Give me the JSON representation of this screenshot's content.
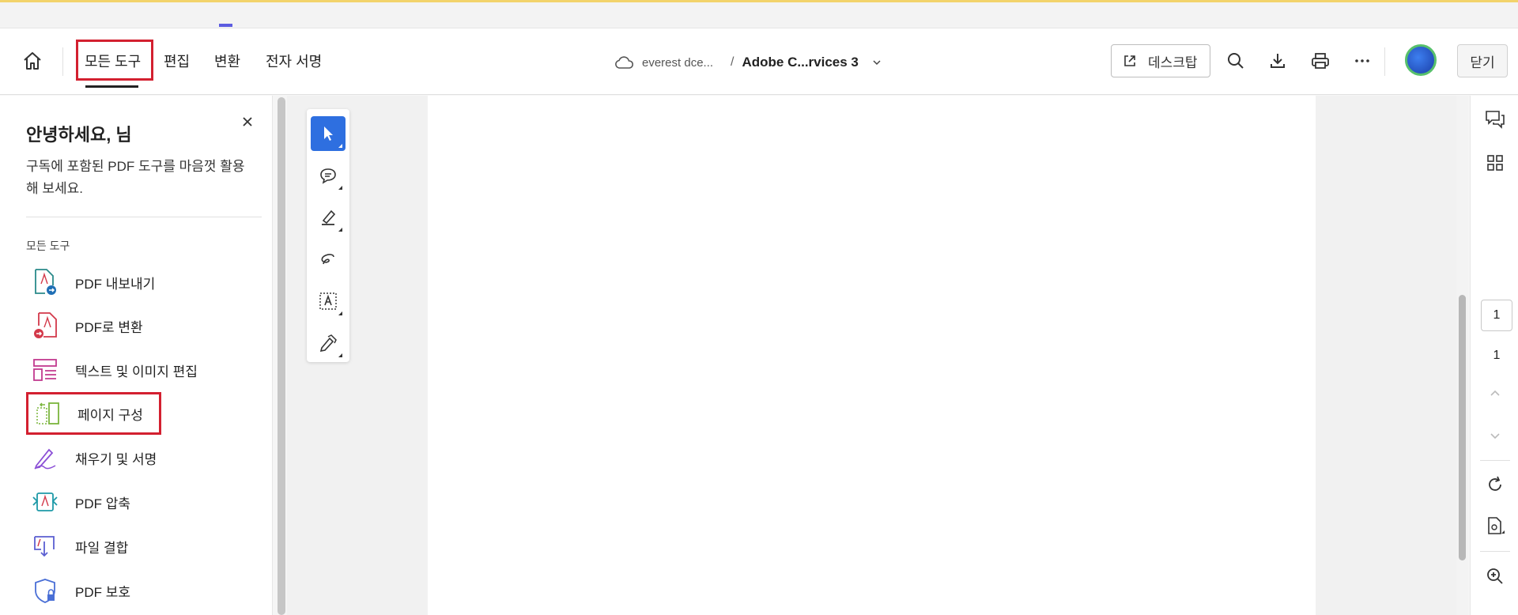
{
  "header": {
    "nav_tabs": [
      {
        "label": "모든 도구"
      },
      {
        "label": "편집"
      },
      {
        "label": "변환"
      },
      {
        "label": "전자 서명"
      }
    ],
    "breadcrumb": {
      "folder": "everest dce...",
      "separator": "/",
      "document": "Adobe C...rvices 3"
    },
    "desktop_button": "데스크탑",
    "close_button": "닫기",
    "icons": [
      "home-icon",
      "cloud-icon",
      "search-icon",
      "download-icon",
      "print-icon",
      "more-icon"
    ]
  },
  "left_panel": {
    "greeting": "안녕하세요, 님",
    "description": "구독에 포함된 PDF 도구를 마음껏 활용해 보세요.",
    "section_label": "모든 도구",
    "tools": [
      {
        "label": "PDF 내보내기",
        "icon": "pdf-export-icon",
        "color": "#2a8a8a"
      },
      {
        "label": "PDF로 변환",
        "icon": "pdf-convert-icon",
        "color": "#d3394a"
      },
      {
        "label": "텍스트 및 이미지 편집",
        "icon": "edit-text-image-icon",
        "color": "#c23a8f"
      },
      {
        "label": "페이지 구성",
        "icon": "organize-pages-icon",
        "color": "#7bb53d"
      },
      {
        "label": "채우기 및 서명",
        "icon": "fill-sign-icon",
        "color": "#8b4fd6"
      },
      {
        "label": "PDF 압축",
        "icon": "compress-pdf-icon",
        "color": "#1e9aa8"
      },
      {
        "label": "파일 결합",
        "icon": "combine-files-icon",
        "color": "#5b5fd1"
      },
      {
        "label": "PDF 보호",
        "icon": "protect-pdf-icon",
        "color": "#4a6fd6"
      }
    ]
  },
  "toolbar": {
    "tools": [
      "select-icon",
      "comment-icon",
      "highlight-icon",
      "draw-icon",
      "text-box-icon",
      "sign-icon"
    ]
  },
  "right_rail": {
    "current_page": "1",
    "total_pages": "1",
    "icons": [
      "comments-icon",
      "thumbnails-icon",
      "page-up-icon",
      "page-down-icon",
      "rotate-icon",
      "page-options-icon",
      "zoom-in-icon"
    ]
  },
  "colors": {
    "accent": "#2e6fe0",
    "highlight_box": "#d32030"
  }
}
